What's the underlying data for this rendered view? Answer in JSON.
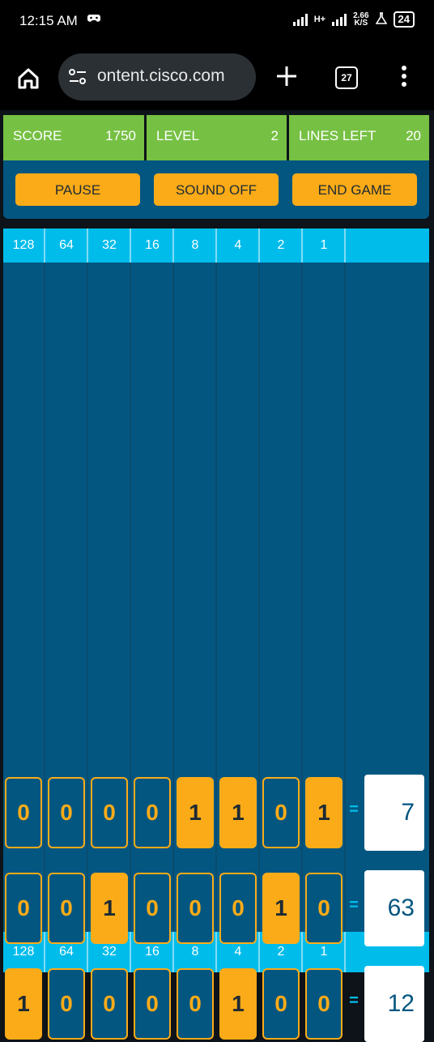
{
  "status_bar": {
    "time": "12:15 AM",
    "network_type": "H+",
    "data_speed_value": "2.66",
    "data_speed_unit": "K/S",
    "battery": "24"
  },
  "browser": {
    "url": "ontent.cisco.com",
    "tab_count": "27"
  },
  "stats": {
    "score_label": "SCORE",
    "score_value": "1750",
    "level_label": "LEVEL",
    "level_value": "2",
    "lines_label": "LINES LEFT",
    "lines_value": "20"
  },
  "controls": {
    "pause": "PAUSE",
    "sound": "SOUND OFF",
    "end": "END GAME"
  },
  "columns": [
    "128",
    "64",
    "32",
    "16",
    "8",
    "4",
    "2",
    "1"
  ],
  "rows": [
    {
      "bits": [
        "0",
        "0",
        "0",
        "0",
        "1",
        "1",
        "0",
        "1"
      ],
      "equals": "=",
      "answer": "7"
    },
    {
      "bits": [
        "0",
        "0",
        "1",
        "0",
        "0",
        "0",
        "1",
        "0"
      ],
      "equals": "=",
      "answer": "63"
    },
    {
      "bits": [
        "1",
        "0",
        "0",
        "0",
        "0",
        "1",
        "0",
        "0"
      ],
      "equals": "=",
      "answer": "12"
    }
  ],
  "colors": {
    "accent_green": "#76c043",
    "accent_orange": "#fbab18",
    "board_blue": "#035680",
    "header_cyan": "#00bceb"
  }
}
